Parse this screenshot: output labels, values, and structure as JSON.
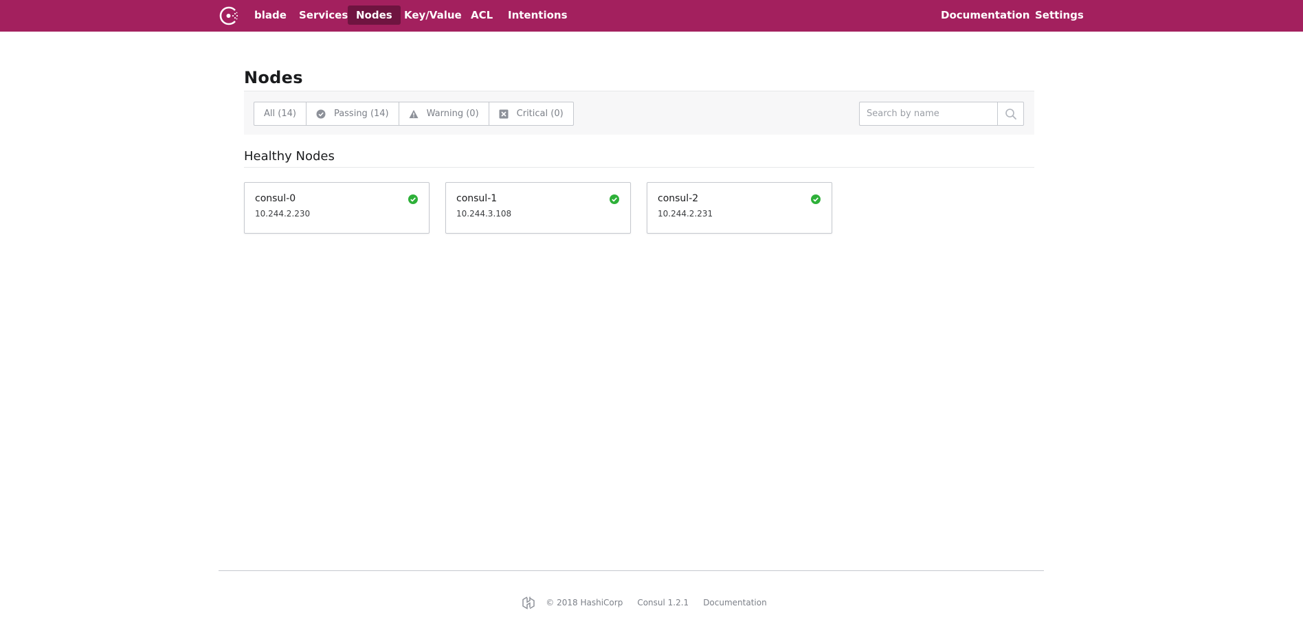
{
  "nav": {
    "logo_icon": "consul-logo-icon",
    "datacenter": "blade",
    "items": [
      "Services",
      "Nodes",
      "Key/Value",
      "ACL",
      "Intentions"
    ],
    "active": "Nodes",
    "right_items": [
      "Documentation",
      "Settings"
    ],
    "color": "#a3205e",
    "active_color": "#6f1440"
  },
  "page": {
    "title": "Nodes"
  },
  "filters": [
    {
      "label": "All (14)",
      "icon": ""
    },
    {
      "label": "Passing (14)",
      "icon": "check-circle-icon"
    },
    {
      "label": "Warning (0)",
      "icon": "warning-triangle-icon"
    },
    {
      "label": "Critical (0)",
      "icon": "critical-x-icon"
    }
  ],
  "search": {
    "placeholder": "Search by name",
    "value": "",
    "icon": "search-icon"
  },
  "section": {
    "title": "Healthy Nodes"
  },
  "nodes": [
    {
      "name": "consul-0",
      "address": "10.244.2.230",
      "status": "passing"
    },
    {
      "name": "consul-1",
      "address": "10.244.3.108",
      "status": "passing"
    },
    {
      "name": "consul-2",
      "address": "10.244.2.231",
      "status": "passing"
    }
  ],
  "status_colors": {
    "passing": "#2eb039"
  },
  "footer": {
    "logo_icon": "hashicorp-logo-icon",
    "copyright": "© 2018 HashiCorp",
    "version": "Consul 1.2.1",
    "documentation": "Documentation"
  }
}
